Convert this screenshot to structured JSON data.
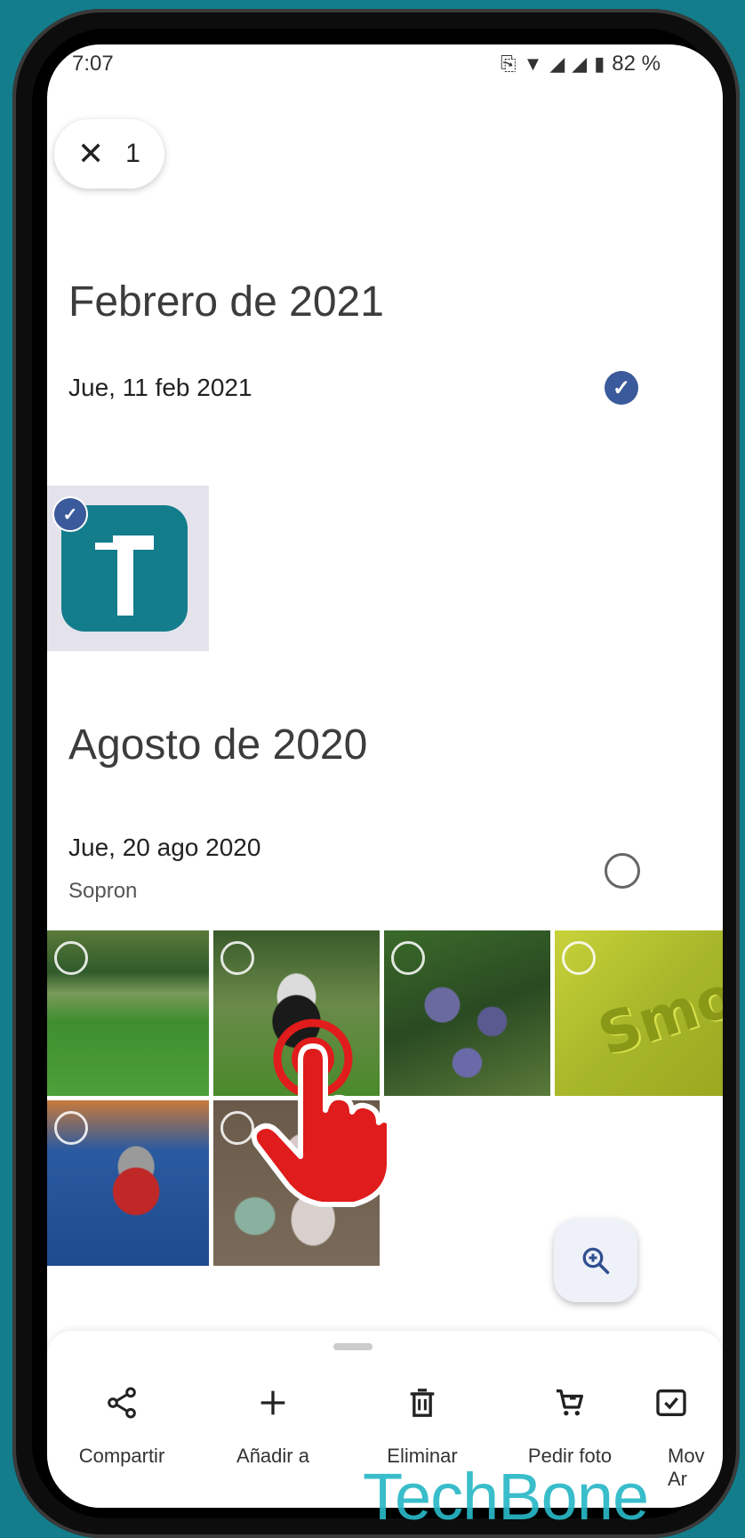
{
  "status_bar": {
    "time": "7:07",
    "battery": "82 %"
  },
  "selection": {
    "close_icon": "close-icon",
    "count": "1"
  },
  "sections": [
    {
      "month": "Febrero de 2021",
      "day": "Jue, 11 feb 2021",
      "place": "",
      "selected": true
    },
    {
      "month": "Agosto de 2020",
      "day": "Jue, 20 ago 2020",
      "place": "Sopron",
      "selected": false
    }
  ],
  "photos": {
    "smoby_text": "Smoby"
  },
  "actions": [
    {
      "label": "Compartir",
      "icon": "share-icon"
    },
    {
      "label": "Añadir a",
      "icon": "plus-icon"
    },
    {
      "label": "Eliminar",
      "icon": "trash-icon"
    },
    {
      "label": "Pedir foto",
      "icon": "cart-icon"
    },
    {
      "label": "Mov Ar",
      "icon": "archive-icon"
    }
  ],
  "watermark": "TechBone",
  "colors": {
    "accent": "#3b5a9b",
    "frame": "#137d8c",
    "watermark": "#29b8c6"
  }
}
